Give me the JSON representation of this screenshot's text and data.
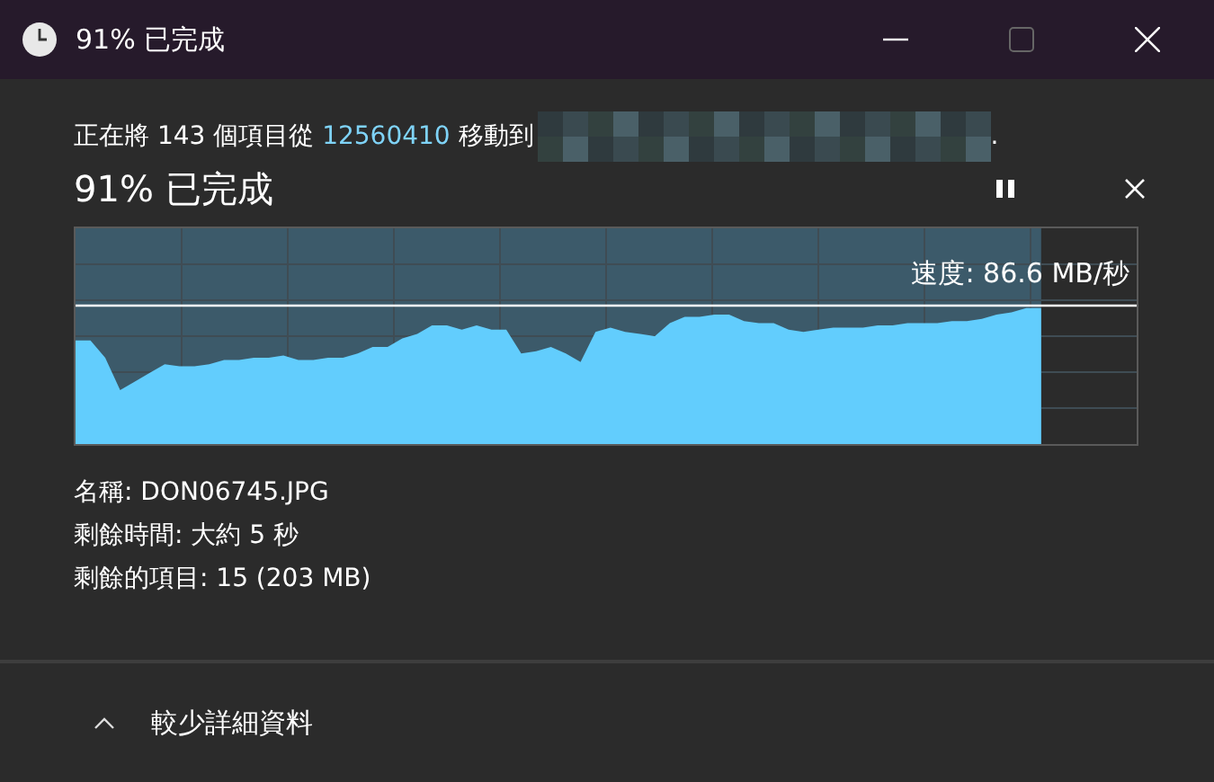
{
  "window": {
    "title": "91% 已完成"
  },
  "message": {
    "prefix": "正在將 143 個項目從 ",
    "source": "12560410",
    "middle": " 移動到",
    "suffix": "."
  },
  "progress": {
    "heading": "91% 已完成",
    "level": 0.91,
    "speed": "速度: 86.6 MB/秒"
  },
  "details": [
    {
      "label": "名稱:",
      "value": "DON06745.JPG"
    },
    {
      "label": "剩餘時間:",
      "value": "大約 5 秒"
    },
    {
      "label": "剩餘的項目:",
      "value": "15 (203 MB)"
    }
  ],
  "footer": {
    "toggle": "較少詳細資料",
    "expanded": true
  }
}
